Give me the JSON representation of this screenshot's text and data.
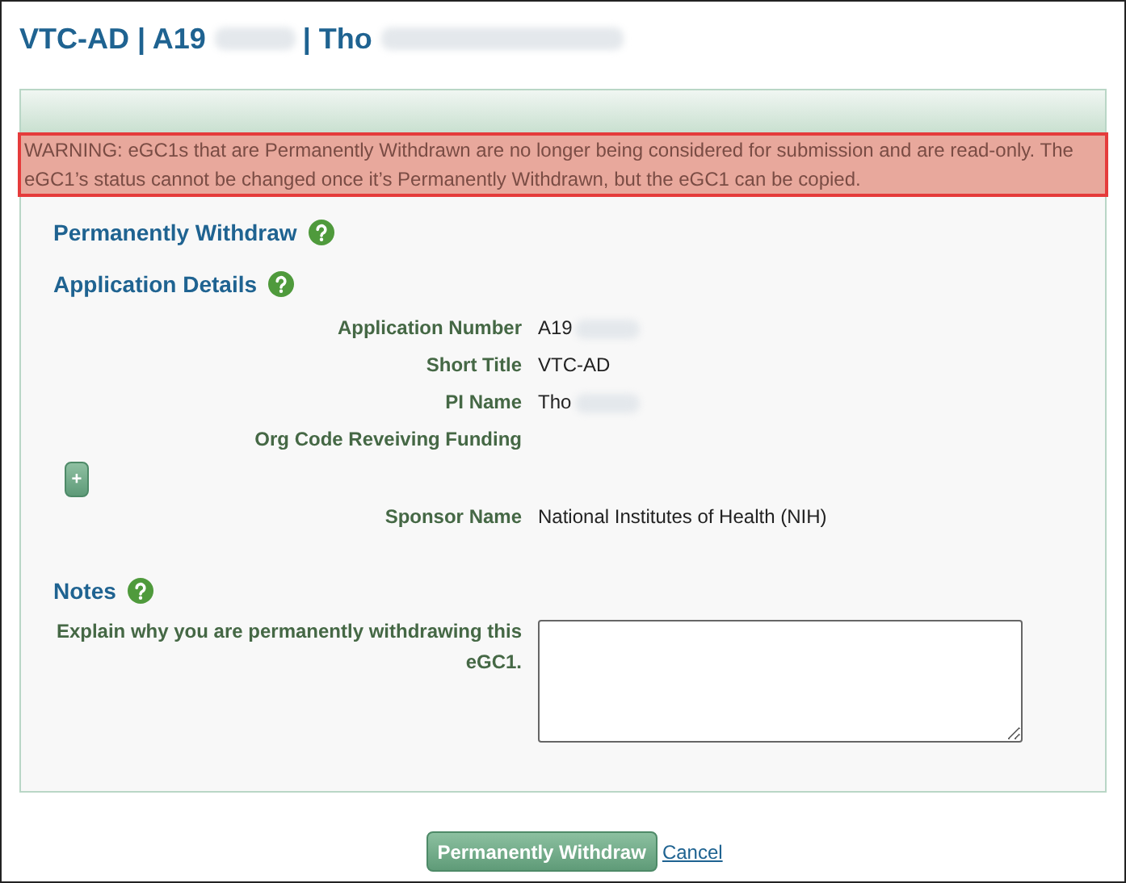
{
  "page_title": {
    "segments": [
      "VTC-AD | A19",
      "| Tho"
    ]
  },
  "warning": "WARNING: eGC1s that are Permanently Withdrawn are no longer being considered for submission and are read-only. The eGC1’s status cannot be changed once it’s Permanently Withdrawn, but the eGC1 can be copied.",
  "sections": [
    {
      "heading": "Permanently Withdraw"
    },
    {
      "heading": "Application Details",
      "rows": [
        {
          "kind": "field",
          "label": "Application Number",
          "value": "A19",
          "redacted": true
        },
        {
          "kind": "field",
          "label": "Short Title",
          "value": "VTC-AD",
          "redacted": false
        },
        {
          "kind": "field",
          "label": "PI Name",
          "value": "Tho",
          "redacted": true
        },
        {
          "kind": "field",
          "label": "Org Code Reveiving Funding",
          "value": "",
          "redacted": false
        },
        {
          "kind": "add_button",
          "label": "+"
        },
        {
          "kind": "field",
          "label": "Sponsor Name",
          "value": "National Institutes of Health (NIH)",
          "redacted": false
        }
      ]
    },
    {
      "heading": "Notes",
      "rows": [
        {
          "kind": "textarea",
          "label": "Explain why you are permanently withdrawing this eGC1."
        }
      ]
    }
  ],
  "actions": [
    {
      "kind": "button",
      "label": "Permanently Withdraw"
    },
    {
      "kind": "link",
      "label": "Cancel"
    }
  ]
}
